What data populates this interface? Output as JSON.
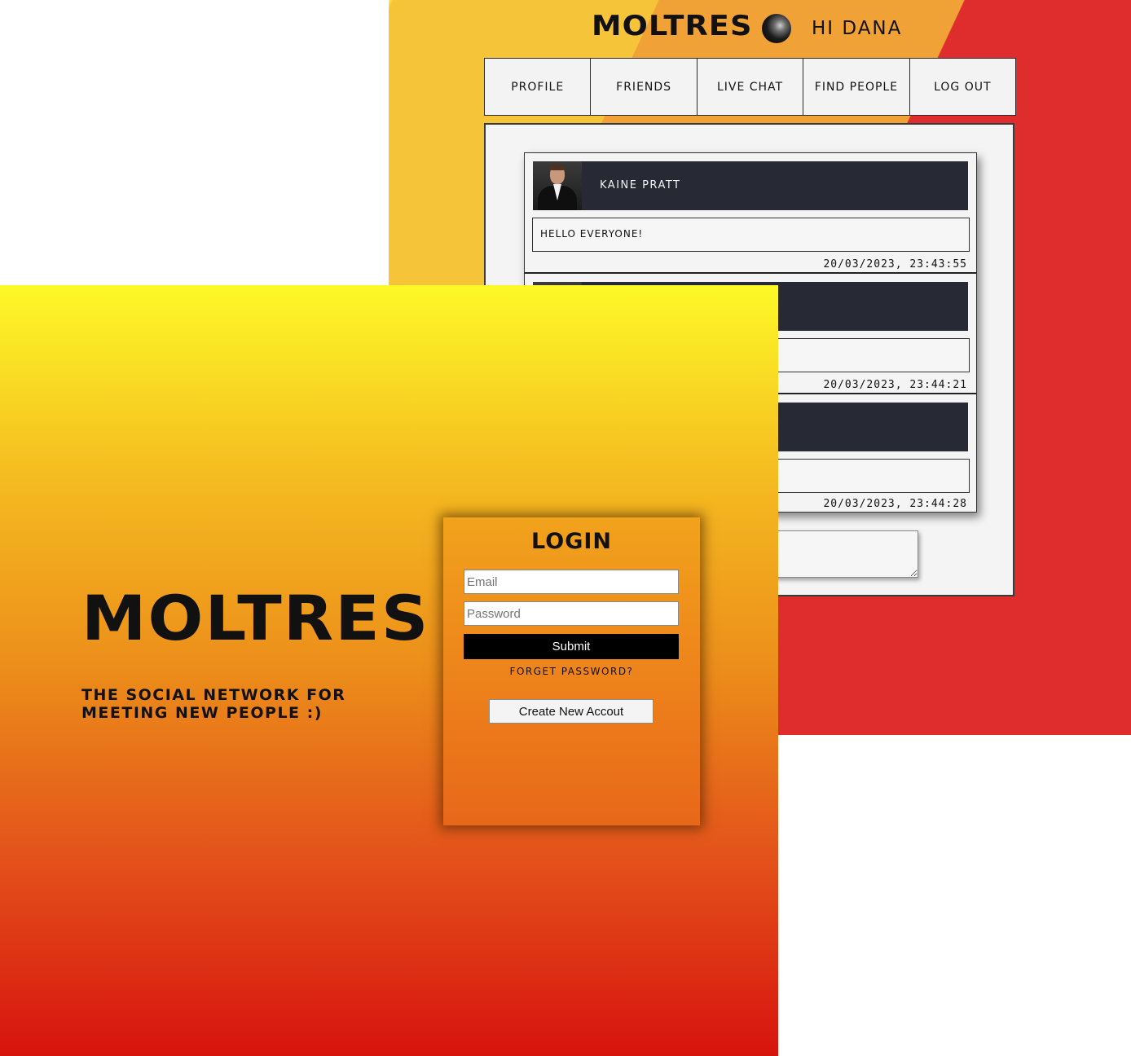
{
  "chat_page": {
    "brand": "MOLTRES",
    "greeting": "HI DANA",
    "nav": [
      {
        "label": "PROFILE"
      },
      {
        "label": "FRIENDS"
      },
      {
        "label": "LIVE CHAT"
      },
      {
        "label": "FIND PEOPLE"
      },
      {
        "label": "LOG OUT"
      }
    ],
    "messages": [
      {
        "author": "KAINE PRATT",
        "text": "HELLO EVERYONE!",
        "timestamp": "20/03/2023, 23:43:55"
      },
      {
        "author": "",
        "text": "",
        "timestamp": "20/03/2023, 23:44:21"
      },
      {
        "author": "",
        "text": "",
        "timestamp": "20/03/2023, 23:44:28"
      }
    ]
  },
  "login_page": {
    "brand": "MOLTRES",
    "tagline": "THE SOCIAL NETWORK FOR MEETING NEW PEOPLE :)",
    "form": {
      "heading": "LOGIN",
      "email_placeholder": "Email",
      "password_placeholder": "Password",
      "submit_label": "Submit",
      "forgot_label": "FORGET PASSWORD?",
      "create_label": "Create New Accout"
    }
  }
}
